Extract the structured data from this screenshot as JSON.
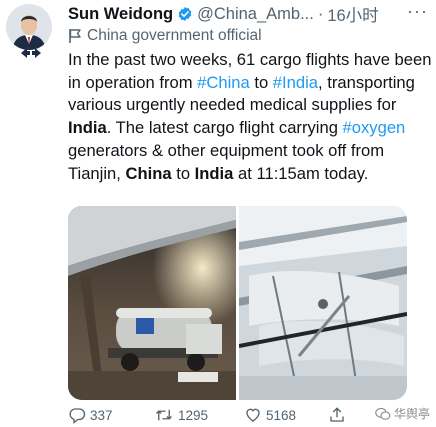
{
  "author": {
    "name": "Sun Weidong",
    "handle": "@China_Amb...",
    "separator": "·",
    "time": "16小时",
    "more": "···",
    "label": "China government official"
  },
  "tweet": {
    "t1": "In the past two weeks, 61 cargo flights have been in operation from ",
    "h1": "#China",
    "t2": " to ",
    "h2": "#India",
    "t3": ", transporting various urgently needed medical supplies for ",
    "b1": "India",
    "t4": ". The latest cargo flight carrying ",
    "h3": "#oxygen",
    "t5": " generators & other equipment took off from Tianjin, ",
    "b2": "China",
    "t6": " to ",
    "b3": "India",
    "t7": " at 11:15am today."
  },
  "actions": {
    "replies": "337",
    "retweets": "1295",
    "likes": "5168"
  },
  "watermark": "华舆亭",
  "icons": [
    "verified-badge-icon",
    "government-label-icon",
    "reply-icon",
    "retweet-icon",
    "like-icon",
    "share-icon",
    "more-icon"
  ],
  "colors": {
    "link": "#1d9bf0",
    "muted": "#536471",
    "text": "#0f1419"
  }
}
